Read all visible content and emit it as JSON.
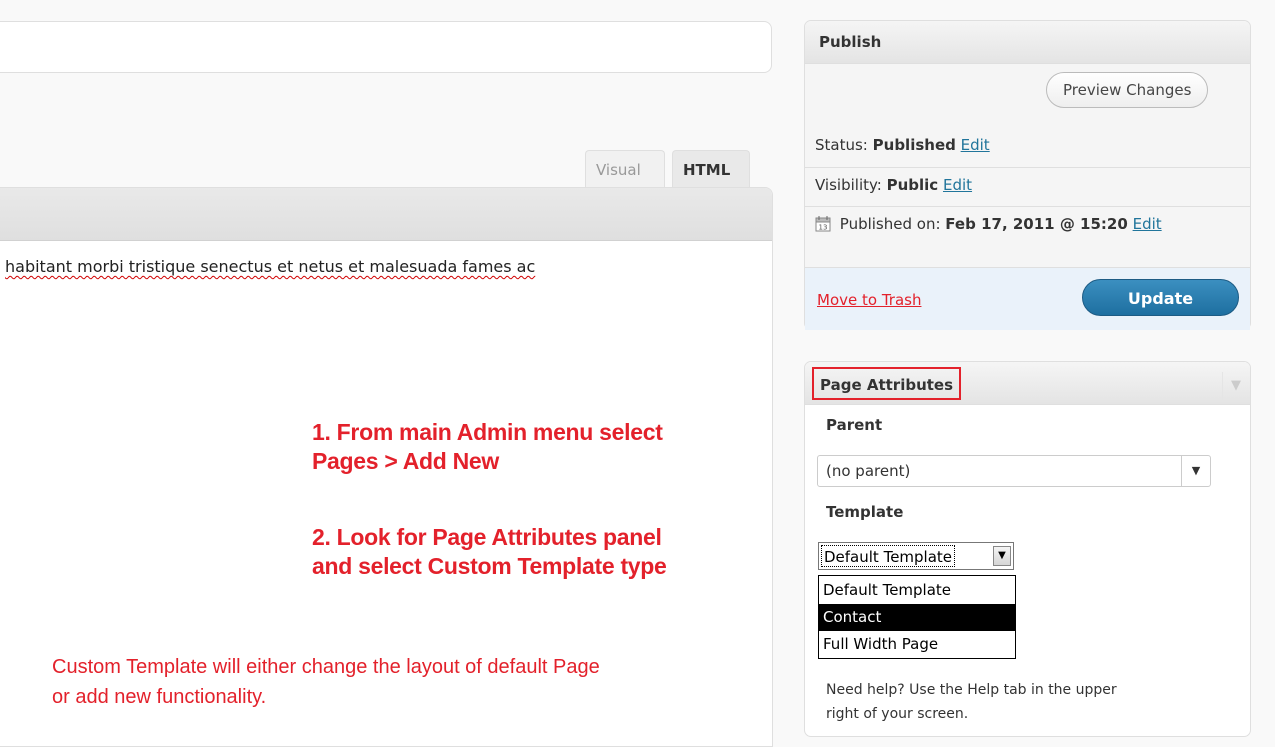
{
  "editor": {
    "tabs": [
      {
        "label": "Visual"
      },
      {
        "label": "HTML"
      }
    ],
    "content_text": "habitant morbi tristique senectus et netus et malesuada fames ac"
  },
  "annotations": {
    "step1_line1": "1. From main Admin menu select",
    "step1_line2": "Pages > Add New",
    "step2_line1": "2. Look for Page Attributes panel",
    "step2_line2": "and select Custom Template type",
    "custom_line1": "Custom Template will either change the layout of default Page",
    "custom_line2": "or add new functionality.",
    "accent_color": "#e3212b"
  },
  "publish": {
    "title": "Publish",
    "preview_label": "Preview Changes",
    "status_label": "Status:",
    "status_value": "Published",
    "visibility_label": "Visibility:",
    "visibility_value": "Public",
    "published_on_label": "Published on:",
    "published_on_value": "Feb 17, 2011 @ 15:20",
    "edit_label": "Edit",
    "move_to_trash": "Move to Trash",
    "update_label": "Update",
    "calendar_icon": "calendar-icon"
  },
  "page_attributes": {
    "title": "Page Attributes",
    "parent_label": "Parent",
    "parent_value": "(no parent)",
    "template_label": "Template",
    "template_value": "Default Template",
    "template_options": [
      {
        "label": "Default Template",
        "selected": false
      },
      {
        "label": "Contact",
        "selected": true
      },
      {
        "label": "Full Width Page",
        "selected": false
      }
    ],
    "help_line1": "Need help? Use the Help tab in the upper",
    "help_line2": "right of your screen."
  }
}
